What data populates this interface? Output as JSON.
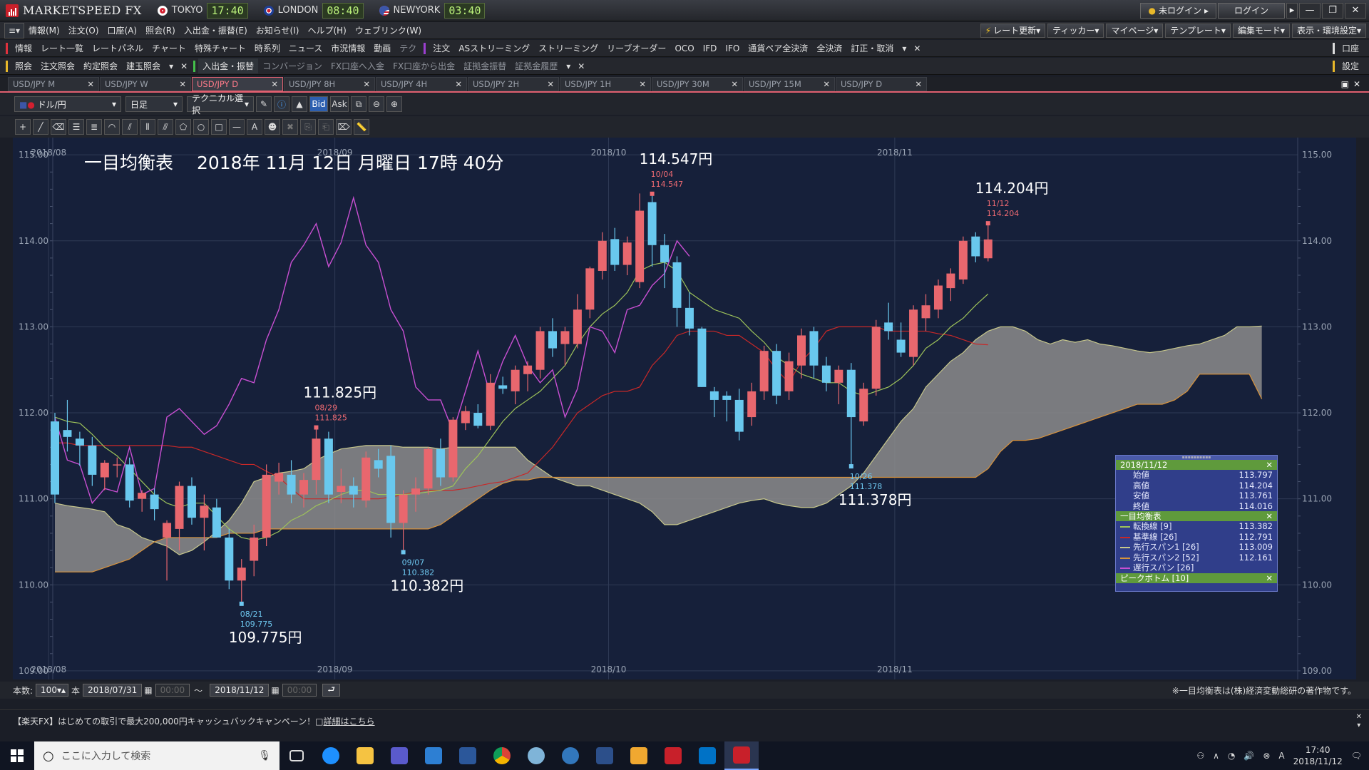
{
  "app": {
    "title": "MARKETSPEED FX",
    "clocks": [
      {
        "city": "TOKYO",
        "time": "17:40",
        "flag": "#d32030"
      },
      {
        "city": "LONDON",
        "time": "08:40",
        "flag": "#1f3f99"
      },
      {
        "city": "NEWYORK",
        "time": "03:40",
        "flag": "#3c56a8"
      }
    ],
    "login_status": "未ログイン",
    "login_button": "ログイン"
  },
  "menubar": {
    "items": [
      "情報(M)",
      "注文(O)",
      "口座(A)",
      "照会(R)",
      "入出金・振替(E)",
      "お知らせ(I)",
      "ヘルプ(H)",
      "ウェブリンク(W)"
    ],
    "right": [
      "レート更新",
      "ティッカー",
      "マイページ",
      "テンプレート",
      "編集モード",
      "表示・環境設定"
    ]
  },
  "toolbar1": {
    "label": "情報",
    "items": [
      "レート一覧",
      "レートパネル",
      "チャート",
      "特殊チャート",
      "時系列",
      "ニュース",
      "市況情報",
      "動画",
      "テク"
    ],
    "order_label": "注文",
    "order_items": [
      "ASストリーミング",
      "ストリーミング",
      "リーブオーダー",
      "OCO",
      "IFD",
      "IFO",
      "通貨ペア全決済",
      "全決済",
      "訂正・取消"
    ],
    "right": "口座"
  },
  "toolbar2": {
    "label": "照会",
    "items": [
      "注文照会",
      "約定照会",
      "建玉照会"
    ],
    "transfer_label": "入出金・振替",
    "transfer_items": [
      "コンバージョン",
      "FX口座へ入金",
      "FX口座から出金",
      "証拠金振替",
      "証拠金履歴"
    ],
    "right": "設定"
  },
  "tabs": [
    {
      "label": "USD/JPY M",
      "active": false
    },
    {
      "label": "USD/JPY W",
      "active": false
    },
    {
      "label": "USD/JPY D",
      "active": true
    },
    {
      "label": "USD/JPY 8H",
      "active": false
    },
    {
      "label": "USD/JPY 4H",
      "active": false
    },
    {
      "label": "USD/JPY 2H",
      "active": false
    },
    {
      "label": "USD/JPY 1H",
      "active": false
    },
    {
      "label": "USD/JPY 30M",
      "active": false
    },
    {
      "label": "USD/JPY 15M",
      "active": false
    },
    {
      "label": "USD/JPY D",
      "active": false
    }
  ],
  "chart_controls": {
    "pair": "ドル/円",
    "period": "日足",
    "technical": "テクニカル選択",
    "bid": "Bid",
    "ask": "Ask"
  },
  "chart_data": {
    "type": "candlestick",
    "title": "一目均衡表　 2018年 11月 12日 月曜日 17時 40分",
    "ylim": [
      108.9,
      115.2
    ],
    "yticks": [
      "115.00",
      "114.00",
      "113.00",
      "112.00",
      "111.00",
      "110.00",
      "109.00"
    ],
    "month_labels": [
      "2018/08",
      "2018/09",
      "2018/10",
      "2018/11"
    ],
    "up_color": "#e8676e",
    "down_color": "#69c8ee",
    "candles": [
      {
        "o": 111.9,
        "h": 112.0,
        "l": 110.95,
        "c": 111.05
      },
      {
        "o": 111.8,
        "h": 112.15,
        "l": 111.55,
        "c": 111.72
      },
      {
        "o": 111.7,
        "h": 111.78,
        "l": 111.38,
        "c": 111.62
      },
      {
        "o": 111.62,
        "h": 111.72,
        "l": 111.15,
        "c": 111.28
      },
      {
        "o": 111.25,
        "h": 111.45,
        "l": 111.1,
        "c": 111.42
      },
      {
        "o": 111.4,
        "h": 111.48,
        "l": 111.25,
        "c": 111.4
      },
      {
        "o": 111.4,
        "h": 111.48,
        "l": 110.9,
        "c": 110.98
      },
      {
        "o": 111.0,
        "h": 111.1,
        "l": 110.85,
        "c": 111.07
      },
      {
        "o": 111.05,
        "h": 111.12,
        "l": 110.75,
        "c": 110.88
      },
      {
        "o": 110.55,
        "h": 110.75,
        "l": 110.05,
        "c": 110.72
      },
      {
        "o": 110.65,
        "h": 111.2,
        "l": 110.4,
        "c": 111.15
      },
      {
        "o": 111.15,
        "h": 111.25,
        "l": 110.7,
        "c": 110.78
      },
      {
        "o": 110.78,
        "h": 111.05,
        "l": 110.4,
        "c": 110.92
      },
      {
        "o": 110.9,
        "h": 111.0,
        "l": 110.55,
        "c": 110.55
      },
      {
        "o": 110.55,
        "h": 110.65,
        "l": 109.95,
        "c": 110.05
      },
      {
        "o": 110.05,
        "h": 110.3,
        "l": 109.78,
        "c": 110.2
      },
      {
        "o": 110.28,
        "h": 110.7,
        "l": 110.1,
        "c": 110.55
      },
      {
        "o": 110.55,
        "h": 111.4,
        "l": 110.45,
        "c": 111.28
      },
      {
        "o": 111.2,
        "h": 111.42,
        "l": 111.05,
        "c": 111.3
      },
      {
        "o": 111.28,
        "h": 111.45,
        "l": 110.95,
        "c": 111.05
      },
      {
        "o": 111.05,
        "h": 111.3,
        "l": 110.9,
        "c": 111.22
      },
      {
        "o": 111.22,
        "h": 111.83,
        "l": 111.05,
        "c": 111.7
      },
      {
        "o": 111.7,
        "h": 111.78,
        "l": 110.95,
        "c": 111.05
      },
      {
        "o": 111.08,
        "h": 111.35,
        "l": 110.95,
        "c": 111.15
      },
      {
        "o": 111.15,
        "h": 111.25,
        "l": 110.9,
        "c": 111.05
      },
      {
        "o": 110.98,
        "h": 111.55,
        "l": 110.9,
        "c": 111.48
      },
      {
        "o": 111.45,
        "h": 111.58,
        "l": 111.25,
        "c": 111.35
      },
      {
        "o": 111.5,
        "h": 111.62,
        "l": 110.55,
        "c": 110.72
      },
      {
        "o": 110.72,
        "h": 111.1,
        "l": 110.38,
        "c": 111.05
      },
      {
        "o": 111.05,
        "h": 111.25,
        "l": 110.85,
        "c": 111.12
      },
      {
        "o": 111.12,
        "h": 111.6,
        "l": 111.05,
        "c": 111.58
      },
      {
        "o": 111.58,
        "h": 111.7,
        "l": 111.15,
        "c": 111.25
      },
      {
        "o": 111.25,
        "h": 111.95,
        "l": 111.2,
        "c": 111.92
      },
      {
        "o": 111.88,
        "h": 112.08,
        "l": 111.8,
        "c": 112.02
      },
      {
        "o": 112.0,
        "h": 112.1,
        "l": 111.82,
        "c": 111.85
      },
      {
        "o": 111.85,
        "h": 112.45,
        "l": 111.8,
        "c": 112.35
      },
      {
        "o": 112.32,
        "h": 112.42,
        "l": 112.22,
        "c": 112.28
      },
      {
        "o": 112.25,
        "h": 112.55,
        "l": 112.1,
        "c": 112.5
      },
      {
        "o": 112.45,
        "h": 112.6,
        "l": 112.25,
        "c": 112.55
      },
      {
        "o": 112.5,
        "h": 113.0,
        "l": 112.4,
        "c": 112.95
      },
      {
        "o": 112.95,
        "h": 113.1,
        "l": 112.65,
        "c": 112.75
      },
      {
        "o": 112.8,
        "h": 113.0,
        "l": 112.55,
        "c": 112.95
      },
      {
        "o": 112.8,
        "h": 113.38,
        "l": 112.75,
        "c": 113.2
      },
      {
        "o": 113.2,
        "h": 113.7,
        "l": 113.1,
        "c": 113.68
      },
      {
        "o": 113.65,
        "h": 114.1,
        "l": 113.55,
        "c": 114.0
      },
      {
        "o": 114.02,
        "h": 114.15,
        "l": 113.65,
        "c": 113.72
      },
      {
        "o": 113.72,
        "h": 114.05,
        "l": 113.6,
        "c": 113.98
      },
      {
        "o": 113.52,
        "h": 114.55,
        "l": 113.45,
        "c": 114.35
      },
      {
        "o": 114.45,
        "h": 114.547,
        "l": 113.7,
        "c": 113.95
      },
      {
        "o": 113.95,
        "h": 114.08,
        "l": 113.45,
        "c": 113.75
      },
      {
        "o": 113.75,
        "h": 113.82,
        "l": 113.0,
        "c": 113.22
      },
      {
        "o": 113.22,
        "h": 113.4,
        "l": 112.9,
        "c": 112.98
      },
      {
        "o": 112.98,
        "h": 113.0,
        "l": 112.3,
        "c": 112.3
      },
      {
        "o": 112.25,
        "h": 112.3,
        "l": 111.95,
        "c": 112.15
      },
      {
        "o": 112.2,
        "h": 112.25,
        "l": 111.9,
        "c": 112.15
      },
      {
        "o": 112.15,
        "h": 112.28,
        "l": 111.68,
        "c": 111.78
      },
      {
        "o": 111.95,
        "h": 112.35,
        "l": 111.85,
        "c": 112.25
      },
      {
        "o": 112.25,
        "h": 112.78,
        "l": 112.15,
        "c": 112.72
      },
      {
        "o": 112.72,
        "h": 112.8,
        "l": 112.1,
        "c": 112.2
      },
      {
        "o": 112.25,
        "h": 112.7,
        "l": 112.15,
        "c": 112.6
      },
      {
        "o": 112.55,
        "h": 112.98,
        "l": 112.4,
        "c": 112.9
      },
      {
        "o": 112.95,
        "h": 113.0,
        "l": 112.4,
        "c": 112.55
      },
      {
        "o": 112.55,
        "h": 112.65,
        "l": 112.25,
        "c": 112.35
      },
      {
        "o": 112.35,
        "h": 112.55,
        "l": 112.1,
        "c": 112.5
      },
      {
        "o": 112.5,
        "h": 112.58,
        "l": 111.378,
        "c": 111.95
      },
      {
        "o": 111.9,
        "h": 112.35,
        "l": 111.85,
        "c": 112.28
      },
      {
        "o": 112.28,
        "h": 113.08,
        "l": 112.2,
        "c": 113.0
      },
      {
        "o": 113.05,
        "h": 113.28,
        "l": 112.85,
        "c": 112.95
      },
      {
        "o": 112.85,
        "h": 113.05,
        "l": 112.65,
        "c": 112.7
      },
      {
        "o": 112.65,
        "h": 113.25,
        "l": 112.55,
        "c": 113.2
      },
      {
        "o": 113.1,
        "h": 113.38,
        "l": 112.95,
        "c": 113.25
      },
      {
        "o": 113.2,
        "h": 113.55,
        "l": 113.1,
        "c": 113.48
      },
      {
        "o": 113.45,
        "h": 113.68,
        "l": 113.3,
        "c": 113.62
      },
      {
        "o": 113.55,
        "h": 114.05,
        "l": 113.5,
        "c": 114.0
      },
      {
        "o": 114.05,
        "h": 114.1,
        "l": 113.75,
        "c": 113.82
      },
      {
        "o": 113.797,
        "h": 114.204,
        "l": 113.761,
        "c": 114.016
      }
    ],
    "conversion_line": [
      111.95,
      111.9,
      111.88,
      111.75,
      111.6,
      111.5,
      111.35,
      111.2,
      111.05,
      110.95,
      110.9,
      110.95,
      110.95,
      110.8,
      110.65,
      110.55,
      110.52,
      110.55,
      110.62,
      110.75,
      110.82,
      110.92,
      110.98,
      111.05,
      111.1,
      111.1,
      111.05,
      111.05,
      111.05,
      111.06,
      111.08,
      111.1,
      111.15,
      111.35,
      111.5,
      111.7,
      111.9,
      112.05,
      112.15,
      112.25,
      112.4,
      112.55,
      112.8,
      113.0,
      113.15,
      113.25,
      113.4,
      113.65,
      113.72,
      113.75,
      113.65,
      113.4,
      113.3,
      113.2,
      113.15,
      113.1,
      112.95,
      112.82,
      112.65,
      112.55,
      112.45,
      112.4,
      112.35,
      112.35,
      112.25,
      112.2,
      112.25,
      112.3,
      112.4,
      112.55,
      112.75,
      112.85,
      113.0,
      113.1,
      113.25,
      113.382
    ],
    "base_line": [
      111.65,
      111.65,
      111.62,
      111.62,
      111.62,
      111.62,
      111.62,
      111.62,
      111.62,
      111.62,
      111.6,
      111.6,
      111.55,
      111.5,
      111.45,
      111.4,
      111.4,
      111.32,
      111.25,
      111.12,
      111.0,
      111.0,
      111.0,
      111.0,
      111.0,
      111.0,
      111.0,
      111.02,
      111.05,
      111.08,
      111.1,
      111.1,
      111.1,
      111.12,
      111.15,
      111.18,
      111.2,
      111.25,
      111.3,
      111.45,
      111.6,
      111.8,
      112.0,
      112.1,
      112.2,
      112.25,
      112.25,
      112.3,
      112.55,
      112.7,
      112.9,
      112.95,
      112.95,
      112.95,
      112.9,
      112.9,
      112.8,
      112.7,
      112.5,
      112.35,
      112.6,
      112.75,
      112.95,
      113.0,
      113.0,
      113.0,
      113.0,
      112.95,
      112.95,
      112.95,
      112.95,
      112.92,
      112.9,
      112.85,
      112.8,
      112.791
    ],
    "lagging_line": [
      111.95,
      111.45,
      111.4,
      110.95,
      111.12,
      111.08,
      111.6,
      111.05,
      111.12,
      111.95,
      112.05,
      111.9,
      111.75,
      111.85,
      112.1,
      112.4,
      112.35,
      112.85,
      113.2,
      113.75,
      113.95,
      114.2,
      113.7,
      113.98,
      114.5,
      113.95,
      113.75,
      113.2,
      112.95,
      112.3,
      112.15,
      112.15,
      111.78,
      112.25,
      112.72,
      112.2,
      112.6,
      112.9,
      112.55,
      112.35,
      112.5,
      111.95,
      112.28,
      113.0,
      112.95,
      112.7,
      113.2,
      113.25,
      113.48,
      113.62,
      114.0,
      113.82
    ],
    "span_a": [
      110.95,
      110.92,
      110.9,
      110.88,
      110.85,
      110.7,
      110.65,
      110.55,
      110.5,
      110.45,
      110.35,
      110.4,
      110.5,
      110.62,
      110.75,
      110.95,
      111.2,
      111.25,
      111.3,
      111.32,
      111.35,
      111.45,
      111.52,
      111.58,
      111.6,
      111.62,
      111.62,
      111.62,
      111.6,
      111.6,
      111.6,
      111.58,
      111.6,
      111.6,
      111.6,
      111.6,
      111.6,
      111.6,
      111.45,
      111.35,
      111.25,
      111.2,
      111.15,
      111.15,
      111.1,
      111.05,
      111.0,
      110.95,
      110.85,
      110.7,
      110.7,
      110.75,
      110.8,
      110.85,
      110.9,
      110.95,
      110.98,
      111.0,
      110.95,
      110.92,
      110.9,
      110.9,
      110.95,
      111.05,
      111.15,
      111.3,
      111.5,
      111.7,
      111.9,
      112.05,
      112.3,
      112.45,
      112.6,
      112.7,
      112.85,
      112.95,
      113.0,
      113.0,
      112.95,
      112.85,
      112.8,
      112.85,
      112.82,
      112.85,
      112.8,
      112.78,
      112.75,
      112.72,
      112.7,
      112.72,
      112.75,
      112.78,
      112.8,
      112.85,
      112.9,
      113.0,
      113.0,
      113.009
    ],
    "span_b": [
      110.15,
      110.15,
      110.15,
      110.15,
      110.2,
      110.25,
      110.3,
      110.4,
      110.5,
      110.55,
      110.55,
      110.55,
      110.55,
      110.55,
      110.6,
      110.6,
      110.6,
      110.65,
      110.65,
      110.65,
      110.65,
      110.65,
      110.65,
      110.65,
      110.65,
      110.65,
      110.65,
      110.65,
      110.65,
      110.65,
      110.65,
      110.7,
      110.8,
      110.9,
      111.0,
      111.1,
      111.18,
      111.22,
      111.22,
      111.25,
      111.25,
      111.25,
      111.25,
      111.25,
      111.25,
      111.25,
      111.25,
      111.25,
      111.25,
      111.25,
      111.25,
      111.25,
      111.25,
      111.25,
      111.25,
      111.25,
      111.25,
      111.25,
      111.25,
      111.25,
      111.25,
      111.25,
      111.25,
      111.25,
      111.25,
      111.25,
      111.25,
      111.25,
      111.25,
      111.25,
      111.25,
      111.25,
      111.25,
      111.25,
      111.25,
      111.35,
      111.55,
      111.68,
      111.68,
      111.7,
      111.75,
      111.8,
      111.85,
      111.9,
      111.95,
      112.0,
      112.05,
      112.1,
      112.1,
      112.1,
      112.15,
      112.25,
      112.45,
      112.45,
      112.45,
      112.45,
      112.45,
      112.161
    ],
    "annotations": [
      {
        "big": "109.775円",
        "date": "08/21",
        "price": "109.775",
        "kind": "low",
        "index": 15
      },
      {
        "big": "111.825円",
        "date": "08/29",
        "price": "111.825",
        "kind": "high",
        "index": 21
      },
      {
        "big": "110.382円",
        "date": "09/07",
        "price": "110.382",
        "kind": "low",
        "index": 28
      },
      {
        "big": "114.547円",
        "date": "10/04",
        "price": "114.547",
        "kind": "high",
        "index": 48
      },
      {
        "big": "111.378円",
        "date": "10/26",
        "price": "111.378",
        "kind": "low",
        "index": 64
      },
      {
        "big": "114.204円",
        "date": "11/12",
        "price": "114.204",
        "kind": "high",
        "index": 75
      }
    ],
    "series_colors": {
      "conversion_line": "#9ec35a",
      "base_line": "#c82828",
      "span_a": "#c8c88c",
      "span_b": "#d7923c",
      "lagging_line": "#c84fd2",
      "cloud": "#8c8c8c"
    }
  },
  "info_panel": {
    "date": "2018/11/12",
    "ohlc": [
      {
        "label": "始値",
        "value": "113.797"
      },
      {
        "label": "高値",
        "value": "114.204"
      },
      {
        "label": "安値",
        "value": "113.761"
      },
      {
        "label": "終値",
        "value": "114.016"
      }
    ],
    "ichimoku_label": "一目均衡表",
    "ichimoku": [
      {
        "label": "転換線 [9]",
        "value": "113.382",
        "color": "#9ec35a"
      },
      {
        "label": "基準線 [26]",
        "value": "112.791",
        "color": "#c82828"
      },
      {
        "label": "先行スパン1 [26]",
        "value": "113.009",
        "color": "#c8c88c"
      },
      {
        "label": "先行スパン2 [52]",
        "value": "112.161",
        "color": "#d7923c"
      },
      {
        "label": "遅行スパン [26]",
        "value": "",
        "color": "#c84fd2"
      }
    ],
    "peak_label": "ピークボトム [10]"
  },
  "bottom_bar": {
    "count_label": "本数:",
    "count": "100",
    "unit": "本",
    "from": "2018/07/31",
    "from_time": "00:00",
    "tilde": "～",
    "to": "2018/11/12",
    "to_time": "00:00",
    "copyright": "※一目均衡表は(株)経済変動総研の著作物です。"
  },
  "banner": {
    "text": "【楽天FX】はじめての取引で最大200,000円キャッシュバックキャンペーン！",
    "link": "詳細はこちら"
  },
  "taskbar": {
    "search_placeholder": "ここに入力して検索",
    "time": "17:40",
    "date": "2018/11/12"
  }
}
